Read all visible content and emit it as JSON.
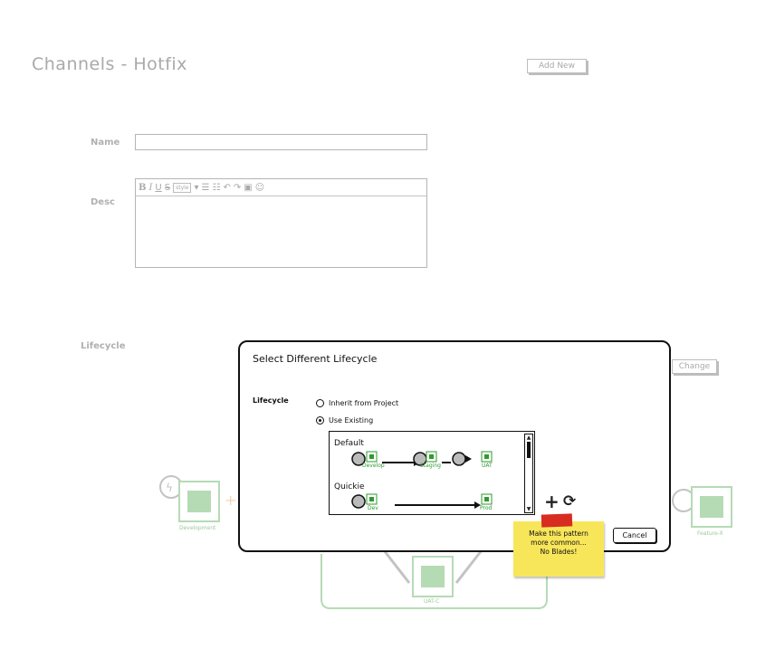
{
  "page": {
    "title": "Channels - Hotfix",
    "add_new_label": "Add New",
    "change_label": "Change"
  },
  "form": {
    "name_label": "Name",
    "name_value": "",
    "desc_label": "Desc",
    "desc_value": "",
    "lifecycle_label": "Lifecycle",
    "toolbar": {
      "bold": "B",
      "italic": "I",
      "underline": "U",
      "strike": "S",
      "style": "style"
    }
  },
  "background_diagram": {
    "nodes": [
      "Development",
      "UAT-C",
      "Feature-X"
    ]
  },
  "dialog": {
    "title": "Select Different Lifecycle",
    "lifecycle_label": "Lifecycle",
    "options": [
      {
        "label": "Inherit from Project",
        "selected": false
      },
      {
        "label": "Use Existing",
        "selected": true
      }
    ],
    "lifecycles": [
      {
        "name": "Default",
        "stages": [
          "Develop",
          "Staging",
          "UAT"
        ]
      },
      {
        "name": "Quickie",
        "stages": [
          "Dev",
          "Prod"
        ]
      }
    ],
    "cancel_label": "Cancel",
    "add_icon": "plus-icon",
    "refresh_icon": "refresh-icon"
  },
  "sticky_note": {
    "lines": [
      "Make this pattern",
      "more common...",
      "No Blades!"
    ]
  },
  "colors": {
    "stage_green": "#2f9a2f",
    "note_yellow": "#f8e65a",
    "tape_red": "#d82c20"
  }
}
